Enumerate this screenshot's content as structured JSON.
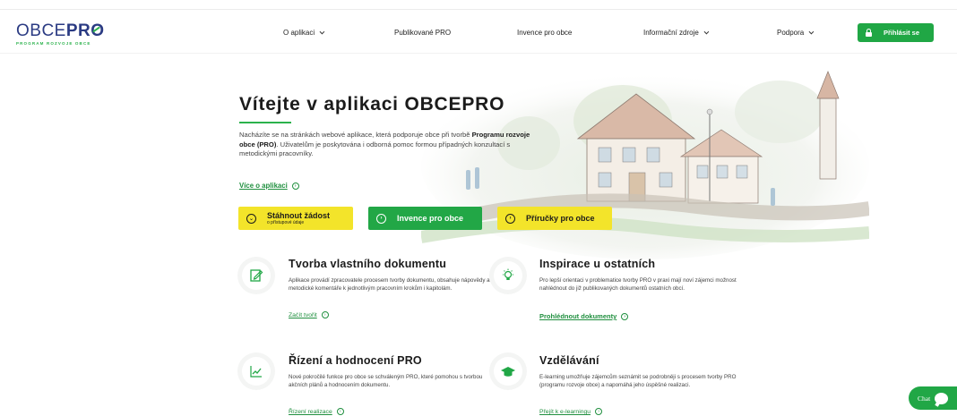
{
  "brand": {
    "logo_obce": "OBCE",
    "logo_pro_p": "PR",
    "logo_pro_o": "O",
    "tagline": "PROGRAM ROZVOJE OBCE",
    "brand_color": "#2b3b83",
    "accent_color": "#2bb24c"
  },
  "nav": {
    "items": [
      {
        "label": "O aplikaci",
        "dropdown": true
      },
      {
        "label": "Publikované PRO",
        "dropdown": false
      },
      {
        "label": "Invence pro obce",
        "dropdown": false
      },
      {
        "label": "Informační zdroje",
        "dropdown": true
      },
      {
        "label": "Podpora",
        "dropdown": true
      }
    ],
    "login_label": "Přihlásit se"
  },
  "hero": {
    "title": "Vítejte v aplikaci OBCEPRO",
    "text_part1": "Nacházíte se na stránkách webové aplikace, která podporuje obce při tvorbě ",
    "text_bold": "Programu rozvoje obce (PRO)",
    "text_part2": ". Uživatelům je poskytována i odborná pomoc formou případných konzultací s metodickými pracovníky.",
    "more_link": "Více o aplikaci",
    "ctas": [
      {
        "label": "Stáhnout žádost",
        "sublabel": "o přístupové údaje",
        "style": "yellow"
      },
      {
        "label": "Invence pro obce",
        "style": "green"
      },
      {
        "label": "Příručky pro obce",
        "style": "yellow"
      }
    ]
  },
  "features": [
    {
      "icon": "document-edit-icon",
      "title": "Tvorba vlastního dokumentu",
      "text": "Aplikace provádí zpracovatele procesem tvorby dokumentu, obsahuje nápovědy a metodické komentáře k jednotlivým pracovním krokům i kapitolám.",
      "link": "Začít tvořit"
    },
    {
      "icon": "lightbulb-icon",
      "title": "Inspirace u ostatních",
      "text": "Pro lepší orientaci v problematice tvorby PRO v praxi mají noví zájemci možnost nahlédnout do již publikovaných dokumentů ostatních obcí.",
      "link": "Prohlédnout dokumenty"
    },
    {
      "icon": "chart-trend-icon",
      "title": "Řízení a hodnocení PRO",
      "text": "Nové pokročilé funkce pro obce se schváleným PRO, které pomohou s tvorbou akčních plánů a hodnocením dokumentu.",
      "link": "Řízení realizace"
    },
    {
      "icon": "graduation-cap-icon",
      "title": "Vzdělávání",
      "text": "E-learning umožňuje zájemcům seznámit se podrobněji s procesem tvorby PRO (programu rozvoje obce) a napomáhá jeho úspěšné realizaci.",
      "link": "Přejít k e-learningu"
    }
  ],
  "chat": {
    "label": "Chat"
  }
}
